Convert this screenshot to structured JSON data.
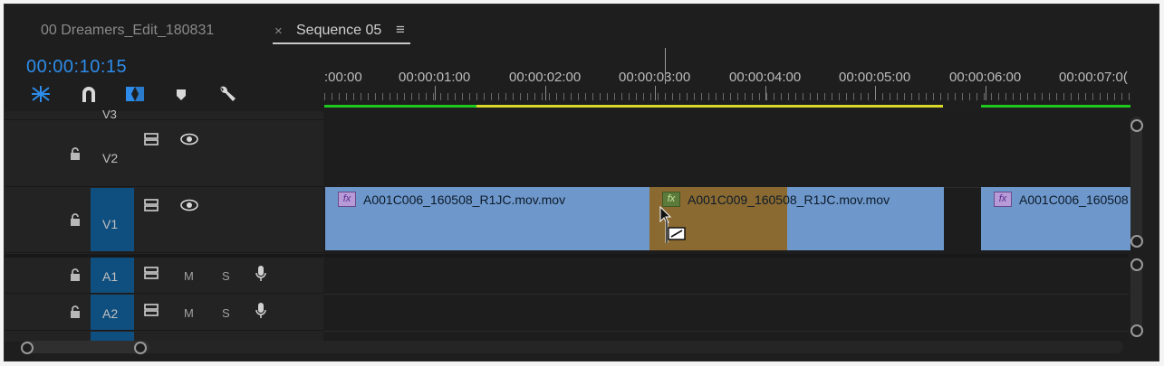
{
  "tabs": [
    {
      "label": "00 Dreamers_Edit_180831",
      "active": false
    },
    {
      "label": "Sequence 05",
      "active": true
    }
  ],
  "tab_close": "×",
  "tab_menu": "≡",
  "timecode": "00:00:10:15",
  "toolbar": {
    "icons": [
      "snap-icon",
      "magnet-icon",
      "linked-selection-icon",
      "marker-icon",
      "wrench-icon"
    ]
  },
  "ruler": {
    "labels": [
      ":00:00",
      "00:00:01:00",
      "00:00:02:00",
      "00:00:03:00",
      "00:00:04:00",
      "00:00:05:00",
      "00:00:06:00",
      "00:00:07:0("
    ]
  },
  "render_bar_colors": {
    "rendered": "#1ec81e",
    "unrendered": "#d8d82a"
  },
  "tracks": {
    "v3": {
      "label": "V3"
    },
    "v2": {
      "label": "V2"
    },
    "v1": {
      "label": "V1"
    },
    "a1": {
      "label": "A1",
      "m": "M",
      "s": "S"
    },
    "a2": {
      "label": "A2",
      "m": "M",
      "s": "S"
    }
  },
  "clips": [
    {
      "fx": "fx",
      "name": "A001C006_160508_R1JC.mov.mov",
      "color": "#6e98cc"
    },
    {
      "fx": "fx",
      "name": "A001C009_160508_R1JC.mov.mov",
      "color": "#6e98cc",
      "selected_color": "#8a6a30"
    },
    {
      "fx": "fx",
      "name": "A001C006_160508",
      "color": "#6e98cc"
    }
  ],
  "colors": {
    "accent": "#2d8ceb",
    "track_target": "#0f4f80",
    "panel_bg": "#1e1e1e"
  }
}
